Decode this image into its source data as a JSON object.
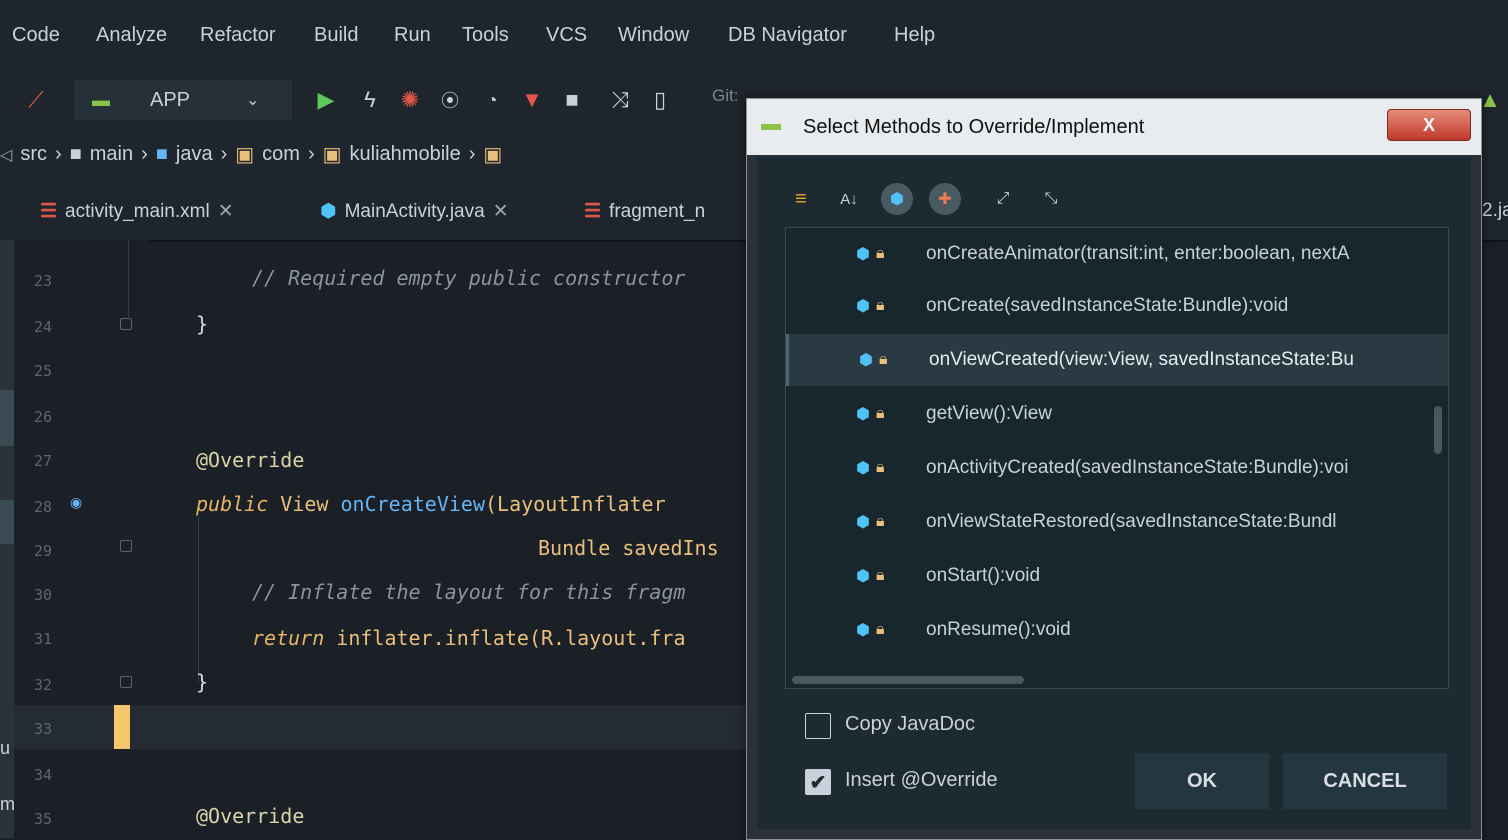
{
  "menu": [
    "Code",
    "Analyze",
    "Refactor",
    "Build",
    "Run",
    "Tools",
    "VCS",
    "Window",
    "DB Navigator",
    "Help"
  ],
  "toolbar": {
    "app_config": "APP",
    "git_label": "Git:"
  },
  "breadcrumb": [
    "src",
    "main",
    "java",
    "com",
    "kuliahmobile"
  ],
  "tabs": [
    "activity_main.xml",
    "MainActivity.java",
    "fragment_n"
  ],
  "tab_right_fragment": "2.ja",
  "editor": {
    "line_numbers": [
      "23",
      "24",
      "25",
      "26",
      "27",
      "28",
      "29",
      "30",
      "31",
      "32",
      "33",
      "34",
      "35"
    ],
    "lines": {
      "l23": "// Required empty public constructor",
      "l24": "}",
      "l27": "@Override",
      "l28_kw": "public",
      "l28_type": "View",
      "l28_fn": "onCreateView",
      "l28_rest": "(LayoutInflater ",
      "l29": "Bundle savedIns",
      "l30": "// Inflate the layout for this fragm",
      "l31_kw": "return",
      "l31_rest": "inflater.inflate(R.layout.fra",
      "l32": "}",
      "l35": "@Override"
    },
    "left_edge_chars": [
      "u",
      "m"
    ]
  },
  "dialog": {
    "title": "Select Methods to Override/Implement",
    "close_label": "X",
    "methods": [
      "onCreateAnimator(transit:int, enter:boolean, nextA",
      "onCreate(savedInstanceState:Bundle):void",
      "onViewCreated(view:View, savedInstanceState:Bu",
      "getView():View",
      "onActivityCreated(savedInstanceState:Bundle):voi",
      "onViewStateRestored(savedInstanceState:Bundl",
      "onStart():void",
      "onResume():void"
    ],
    "selected_index": 2,
    "copy_javadoc_label": "Copy JavaDoc",
    "copy_javadoc_checked": false,
    "insert_override_label": "Insert @Override",
    "insert_override_checked": true,
    "ok_label": "OK",
    "cancel_label": "CANCEL"
  },
  "colors": {
    "accent": "#4fc3f7",
    "caret": "#f6c76a",
    "dialog_bg": "#1d2a31"
  }
}
